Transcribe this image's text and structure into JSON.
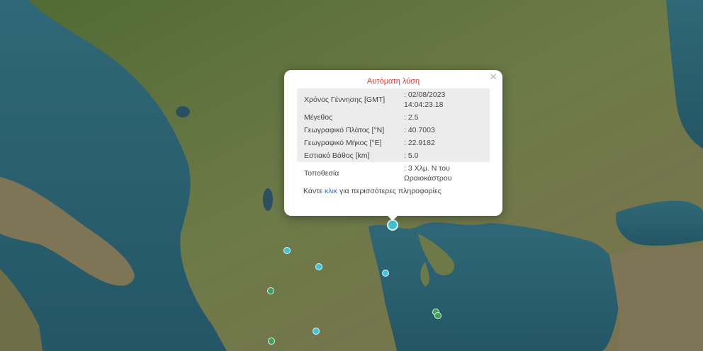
{
  "popup": {
    "title": "Αυτόματη λύση",
    "close_glyph": "×",
    "rows": [
      {
        "label": "Χρόνος Γέννησης [GMT]",
        "value": ": 02/08/2023 14:04:23.18"
      },
      {
        "label": "Μέγεθος",
        "value": ": 2.5"
      },
      {
        "label": "Γεωγραφικό Πλάτος [°N]",
        "value": ": 40.7003"
      },
      {
        "label": "Γεωγραφικό Μήκος [°E]",
        "value": ": 22.9182"
      },
      {
        "label": "Εστιακό Βάθος [km]",
        "value": ": 5.0"
      },
      {
        "label": "Τοποθεσία",
        "value": ": 3 Χλμ. N του Ωραιοκάστρου"
      }
    ],
    "more_prefix": "Κάντε ",
    "more_link": "κλικ",
    "more_suffix": " για περισσότερες πληροφορίες"
  },
  "map": {
    "colors": {
      "sea": "#2b5f6e",
      "land": "#5f7440",
      "title": "#e53935",
      "link": "#1e6fd9",
      "cyan_marker": "#3ec6d6",
      "green_marker": "#3aa05a"
    }
  },
  "markers": [
    {
      "color": "cyan",
      "type": "selected-quake-marker"
    },
    {
      "color": "cyan",
      "type": "quake-marker"
    },
    {
      "color": "cyan",
      "type": "quake-marker"
    },
    {
      "color": "cyan",
      "type": "quake-marker"
    },
    {
      "color": "cyan",
      "type": "quake-marker"
    },
    {
      "color": "green",
      "type": "quake-marker"
    },
    {
      "color": "green",
      "type": "quake-marker"
    },
    {
      "color": "green",
      "type": "quake-marker"
    },
    {
      "color": "green",
      "type": "quake-marker"
    }
  ]
}
